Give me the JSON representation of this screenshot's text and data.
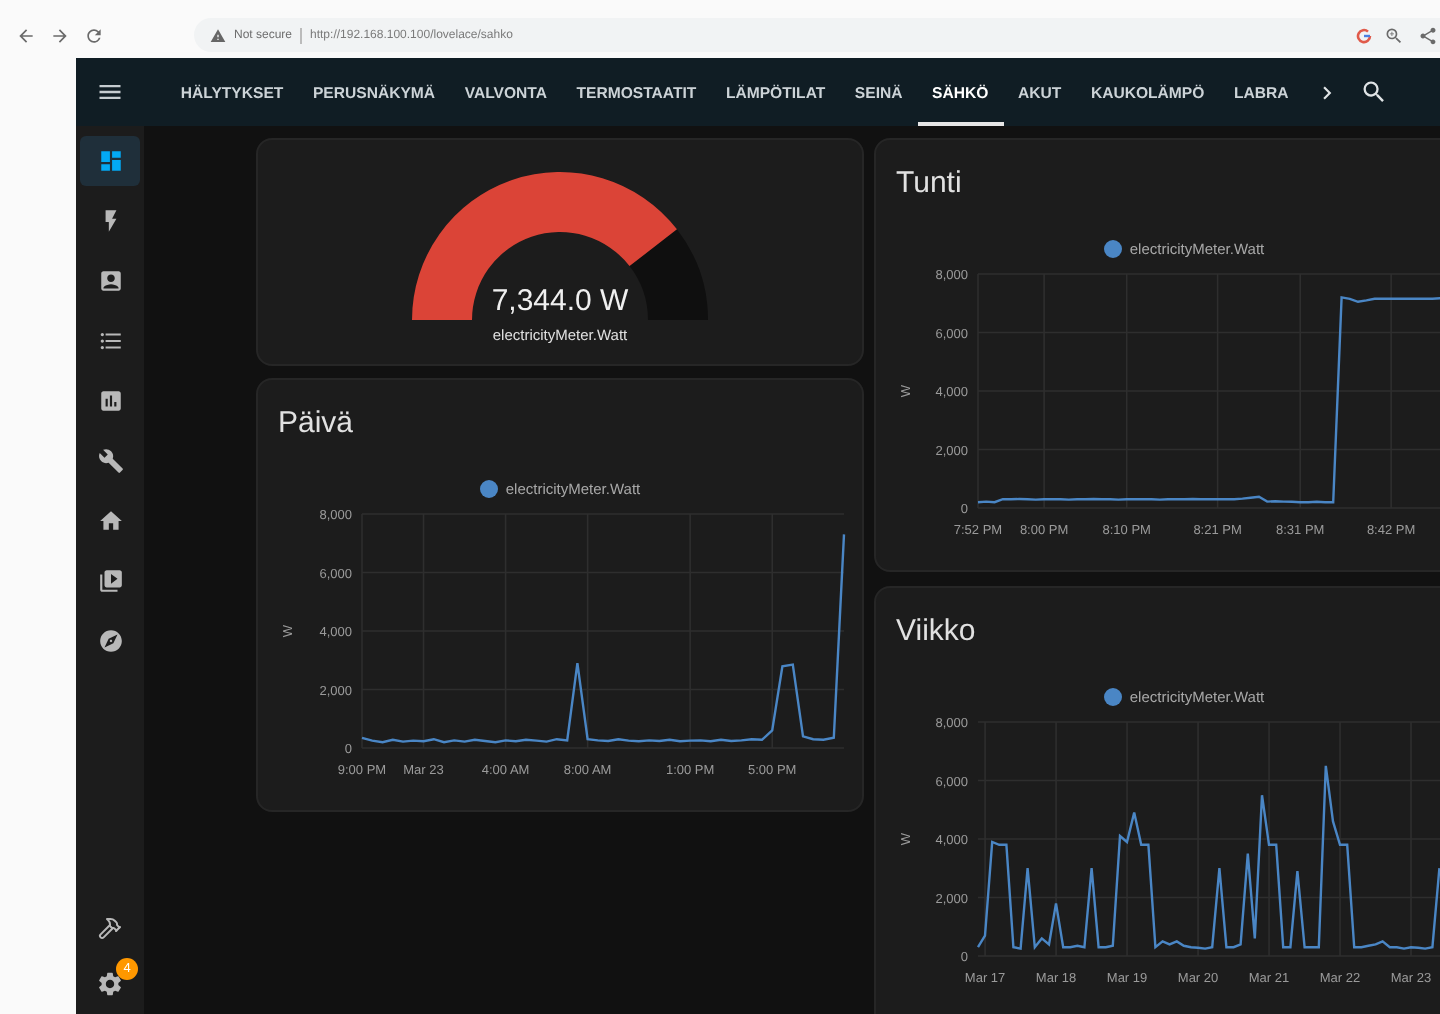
{
  "browser": {
    "security_label": "Not secure",
    "url": "http://192.168.100.100/lovelace/sahko"
  },
  "tabs": [
    {
      "label": "HÄLYTYKSET",
      "selected": false
    },
    {
      "label": "PERUSNÄKYMÄ",
      "selected": false
    },
    {
      "label": "VALVONTA",
      "selected": false
    },
    {
      "label": "TERMOSTAATIT",
      "selected": false
    },
    {
      "label": "LÄMPÖTILAT",
      "selected": false
    },
    {
      "label": "SEINÄ",
      "selected": false
    },
    {
      "label": "SÄHKÖ",
      "selected": true
    },
    {
      "label": "AKUT",
      "selected": false
    },
    {
      "label": "KAUKOLÄMPÖ",
      "selected": false
    },
    {
      "label": "LABRA",
      "selected": false
    }
  ],
  "sidebar": {
    "items": [
      {
        "kind": "dashboard",
        "selected": true
      },
      {
        "kind": "energy",
        "selected": false
      },
      {
        "kind": "person",
        "selected": false
      },
      {
        "kind": "list",
        "selected": false
      },
      {
        "kind": "chart",
        "selected": false
      },
      {
        "kind": "wrench",
        "selected": false
      },
      {
        "kind": "home",
        "selected": false
      },
      {
        "kind": "media",
        "selected": false
      },
      {
        "kind": "compass",
        "selected": false
      }
    ],
    "bottom_items": [
      {
        "kind": "hammer"
      },
      {
        "kind": "settings",
        "badge": "4"
      }
    ]
  },
  "columns": [
    {
      "cards": [
        {
          "kind": "gauge",
          "value": "7,344.0 W",
          "name": "electricityMeter.Watt",
          "level": 0.79
        },
        {
          "kind": "history",
          "title": "Päivä",
          "chart_data": {
            "type": "line",
            "grid": true,
            "ylabel": "W",
            "ylim": [
              0,
              8000
            ],
            "categories": [
              "9:00 PM",
              null,
              null,
              null,
              null,
              null,
              "Mar 23",
              null,
              null,
              null,
              null,
              null,
              null,
              null,
              "4:00 AM",
              null,
              null,
              null,
              null,
              null,
              null,
              null,
              "8:00 AM",
              null,
              null,
              null,
              null,
              null,
              null,
              null,
              null,
              null,
              "1:00 PM",
              null,
              null,
              null,
              null,
              null,
              null,
              null,
              "5:00 PM",
              null,
              null,
              null,
              null,
              null,
              null,
              null
            ],
            "series": [
              {
                "name": "electricityMeter.Watt",
                "color": "#4a86c5",
                "values": [
                  350,
                  250,
                  200,
                  280,
                  220,
                  250,
                  230,
                  300,
                  200,
                  260,
                  220,
                  280,
                  240,
                  200,
                  260,
                  230,
                  280,
                  250,
                  220,
                  300,
                  260,
                  2900,
                  300,
                  260,
                  240,
                  300,
                  250,
                  230,
                  260,
                  240,
                  280,
                  230,
                  250,
                  260,
                  230,
                  280,
                  240,
                  260,
                  300,
                  280,
                  600,
                  2800,
                  2850,
                  400,
                  300,
                  280,
                  350,
                  7300
                ]
              }
            ],
            "yticks": [
              {
                "value": 0,
                "label": "0"
              },
              {
                "value": 2000,
                "label": "2,000"
              },
              {
                "value": 4000,
                "label": "4,000"
              },
              {
                "value": 6000,
                "label": "6,000"
              },
              {
                "value": 8000,
                "label": "8,000"
              }
            ]
          }
        }
      ]
    },
    {
      "cards": [
        {
          "kind": "history",
          "title": "Tunti",
          "chart_data": {
            "type": "line",
            "grid": true,
            "ylabel": "W",
            "ylim": [
              0,
              8000
            ],
            "categories": [
              "7:52 PM",
              null,
              null,
              null,
              null,
              null,
              null,
              null,
              "8:00 PM",
              null,
              null,
              null,
              null,
              null,
              null,
              null,
              null,
              null,
              "8:10 PM",
              null,
              null,
              null,
              null,
              null,
              null,
              null,
              null,
              null,
              null,
              "8:21 PM",
              null,
              null,
              null,
              null,
              null,
              null,
              null,
              null,
              null,
              "8:31 PM",
              null,
              null,
              null,
              null,
              null,
              null,
              null,
              null,
              null,
              null,
              "8:42 PM",
              null,
              null,
              null,
              null,
              null,
              null,
              null,
              null,
              null,
              null,
              null
            ],
            "series": [
              {
                "name": "electricityMeter.Watt",
                "color": "#4a86c5",
                "values": [
                  200,
                  220,
                  200,
                  300,
                  300,
                  310,
                  300,
                  290,
                  300,
                  300,
                  300,
                  290,
                  300,
                  300,
                  310,
                  300,
                  300,
                  290,
                  300,
                  300,
                  300,
                  300,
                  290,
                  300,
                  300,
                  300,
                  310,
                  300,
                  300,
                  300,
                  300,
                  300,
                  320,
                  350,
                  380,
                  220,
                  230,
                  220,
                  210,
                  200,
                  200,
                  210,
                  200,
                  200,
                  7200,
                  7150,
                  7050,
                  7100,
                  7150,
                  7150,
                  7150,
                  7150,
                  7160,
                  7150,
                  7150,
                  7150,
                  7170,
                  7180,
                  null,
                  null,
                  null,
                  null
                ]
              }
            ],
            "yticks": [
              {
                "value": 0,
                "label": "0"
              },
              {
                "value": 2000,
                "label": "2,000"
              },
              {
                "value": 4000,
                "label": "4,000"
              },
              {
                "value": 6000,
                "label": "6,000"
              },
              {
                "value": 8000,
                "label": "8,000"
              }
            ]
          }
        },
        {
          "kind": "history",
          "title": "Viikko",
          "chart_data": {
            "type": "line",
            "grid": true,
            "ylabel": "W",
            "ylim": [
              0,
              8000
            ],
            "categories": [
              null,
              "Mar 17",
              null,
              null,
              null,
              null,
              null,
              null,
              null,
              null,
              null,
              "Mar 18",
              null,
              null,
              null,
              null,
              null,
              null,
              null,
              null,
              null,
              "Mar 19",
              null,
              null,
              null,
              null,
              null,
              null,
              null,
              null,
              null,
              "Mar 20",
              null,
              null,
              null,
              null,
              null,
              null,
              null,
              null,
              null,
              "Mar 21",
              null,
              null,
              null,
              null,
              null,
              null,
              null,
              null,
              null,
              "Mar 22",
              null,
              null,
              null,
              null,
              null,
              null,
              null,
              null,
              null,
              "Mar 23",
              null,
              null,
              null,
              null,
              null,
              null,
              null,
              null,
              null,
              null
            ],
            "series": [
              {
                "name": "electricityMeter.Watt",
                "color": "#4a86c5",
                "values": [
                  300,
                  700,
                  3900,
                  3800,
                  3800,
                  300,
                  250,
                  3000,
                  300,
                  600,
                  400,
                  1800,
                  300,
                  300,
                  350,
                  300,
                  3000,
                  300,
                  300,
                  350,
                  4100,
                  3900,
                  4900,
                  3800,
                  3800,
                  300,
                  500,
                  400,
                  500,
                  350,
                  300,
                  280,
                  250,
                  300,
                  3000,
                  300,
                  300,
                  400,
                  3500,
                  600,
                  5500,
                  3800,
                  3800,
                  300,
                  300,
                  2900,
                  300,
                  300,
                  300,
                  6500,
                  4600,
                  3800,
                  3800,
                  300,
                  300,
                  350,
                  400,
                  500,
                  300,
                  300,
                  250,
                  300,
                  280,
                  250,
                  300,
                  3000,
                  null,
                  null,
                  null,
                  null,
                  null,
                  null
                ]
              }
            ],
            "yticks": [
              {
                "value": 0,
                "label": "0"
              },
              {
                "value": 2000,
                "label": "2,000"
              },
              {
                "value": 4000,
                "label": "4,000"
              },
              {
                "value": 6000,
                "label": "6,000"
              },
              {
                "value": 8000,
                "label": "8,000"
              }
            ]
          }
        }
      ]
    }
  ]
}
